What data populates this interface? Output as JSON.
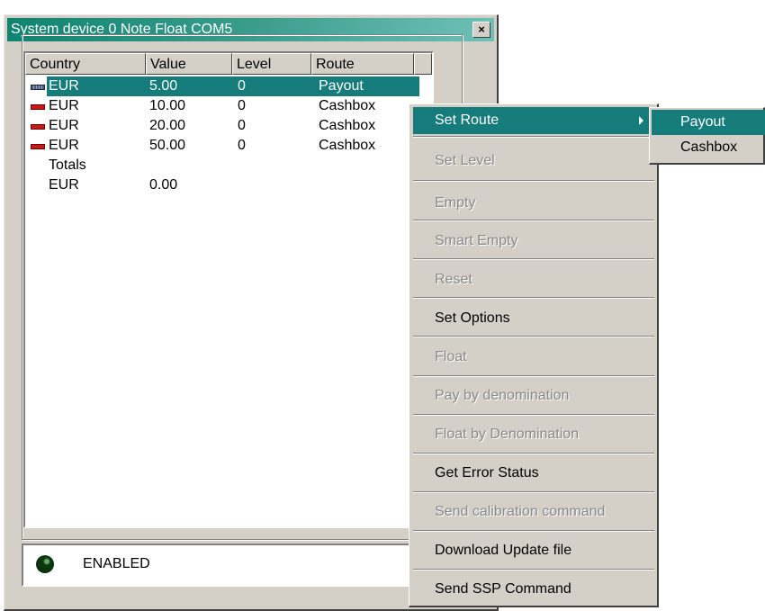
{
  "window": {
    "title": "System device 0 Note Float COM5",
    "close_glyph": "×"
  },
  "listview": {
    "columns": [
      "Country",
      "Value",
      "Level",
      "Route"
    ],
    "rows": [
      {
        "country": "EUR",
        "value": "5.00",
        "level": "0",
        "route": "Payout",
        "icon": "banknote-icon-blue",
        "selected": true
      },
      {
        "country": "EUR",
        "value": "10.00",
        "level": "0",
        "route": "Cashbox",
        "icon": "banknote-icon-red"
      },
      {
        "country": "EUR",
        "value": "20.00",
        "level": "0",
        "route": "Cashbox",
        "icon": "banknote-icon-red"
      },
      {
        "country": "EUR",
        "value": "50.00",
        "level": "0",
        "route": "Cashbox",
        "icon": "banknote-icon-red"
      }
    ],
    "totals_label": "Totals",
    "totals": {
      "country": "EUR",
      "value": "0.00"
    }
  },
  "status": {
    "text": "ENABLED",
    "led_color": "#0c3b10"
  },
  "context_menu": {
    "items": [
      {
        "label": "Set Route",
        "enabled": true,
        "highlighted": true,
        "submenu": true
      },
      {
        "label": "Set  Level",
        "enabled": false
      },
      {
        "label": "Empty",
        "enabled": false
      },
      {
        "label": "Smart Empty",
        "enabled": false
      },
      {
        "label": "Reset",
        "enabled": false
      },
      {
        "label": "Set Options",
        "enabled": true
      },
      {
        "label": "Float",
        "enabled": false
      },
      {
        "label": "Pay by denomination",
        "enabled": false
      },
      {
        "label": "Float by Denomination",
        "enabled": false
      },
      {
        "label": "Get Error Status",
        "enabled": true
      },
      {
        "label": "Send calibration command",
        "enabled": false
      },
      {
        "label": "Download Update file",
        "enabled": true
      },
      {
        "label": "Send SSP Command",
        "enabled": true
      }
    ]
  },
  "submenu": {
    "items": [
      {
        "label": "Payout",
        "highlighted": true
      },
      {
        "label": "Cashbox"
      }
    ]
  },
  "colors": {
    "highlight": "#157b7b",
    "titlebar": "#108470",
    "face": "#d4d0c8"
  }
}
